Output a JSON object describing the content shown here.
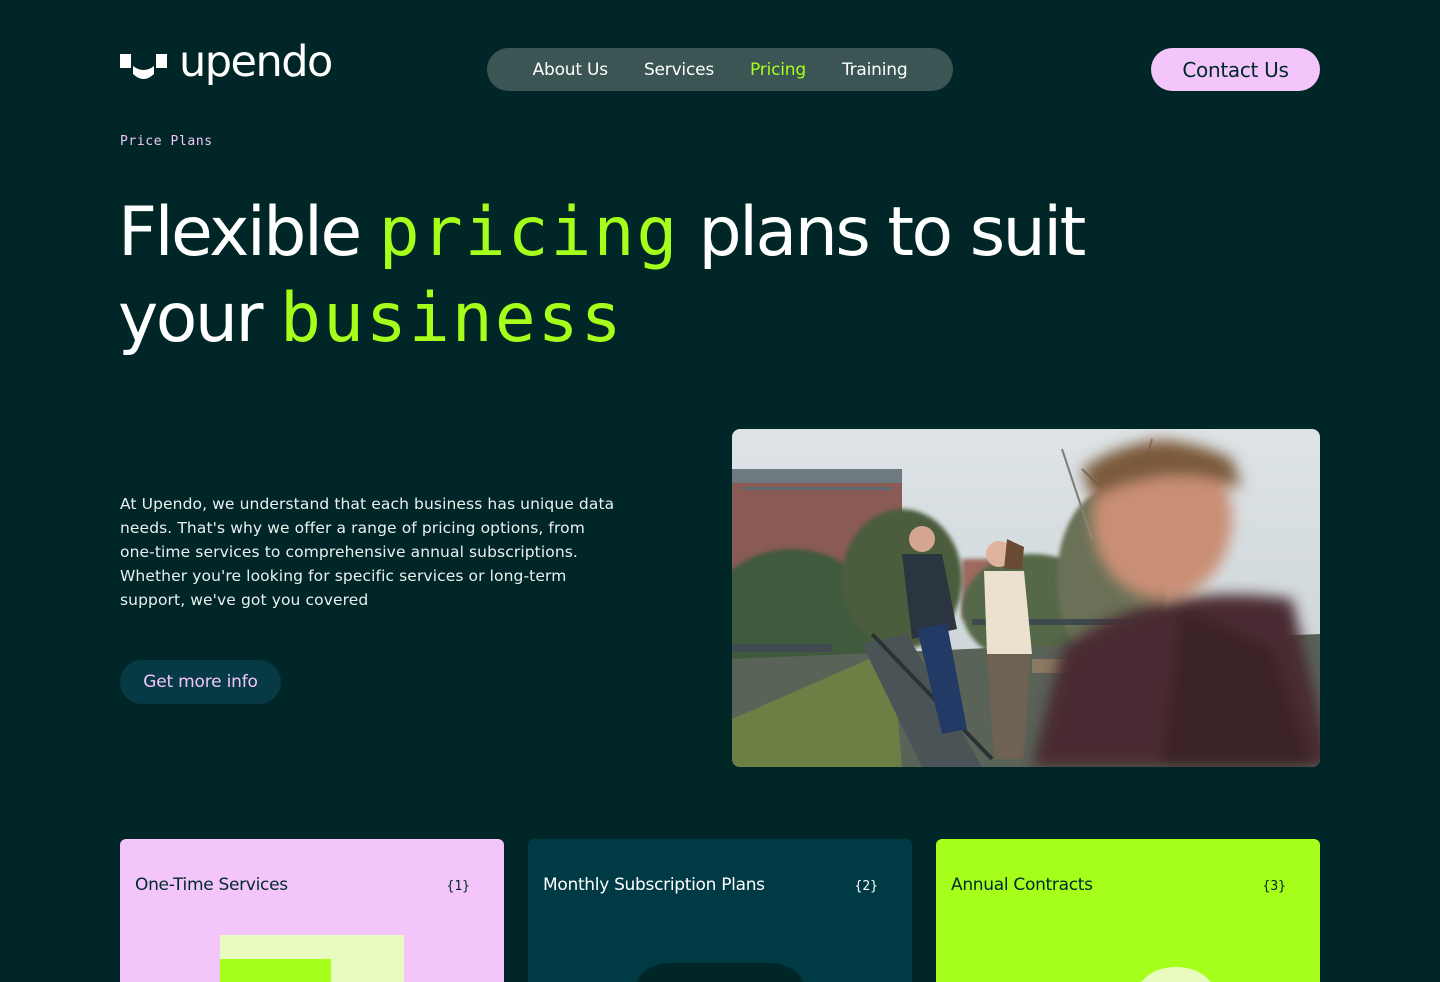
{
  "brand": {
    "name": "upendo"
  },
  "nav": {
    "items": [
      {
        "label": "About Us",
        "active": false
      },
      {
        "label": "Services",
        "active": false
      },
      {
        "label": "Pricing",
        "active": true
      },
      {
        "label": "Training",
        "active": false
      }
    ]
  },
  "header": {
    "contact_label": "Contact Us"
  },
  "hero": {
    "eyebrow": "Price Plans",
    "headline": {
      "part1": "Flexible ",
      "highlight1": "pricing",
      "part2": " plans to suit your ",
      "highlight2": "business"
    },
    "intro": "At Upendo, we understand that each business has unique data needs. That's why we offer a range of pricing options, from one-time services to comprehensive annual subscriptions. Whether you're looking for specific services or long-term support, we've got you covered",
    "cta_label": "Get more info"
  },
  "cards": [
    {
      "title": "One-Time Services",
      "number": "{1}"
    },
    {
      "title": "Monthly Subscription Plans",
      "number": "{2}"
    },
    {
      "title": "Annual Contracts",
      "number": "{3}"
    }
  ],
  "colors": {
    "background": "#002627",
    "accent_green": "#a6ff1a",
    "accent_pink": "#f3c5fb",
    "nav_bg": "#3a5553",
    "card_dark": "#003a45"
  }
}
